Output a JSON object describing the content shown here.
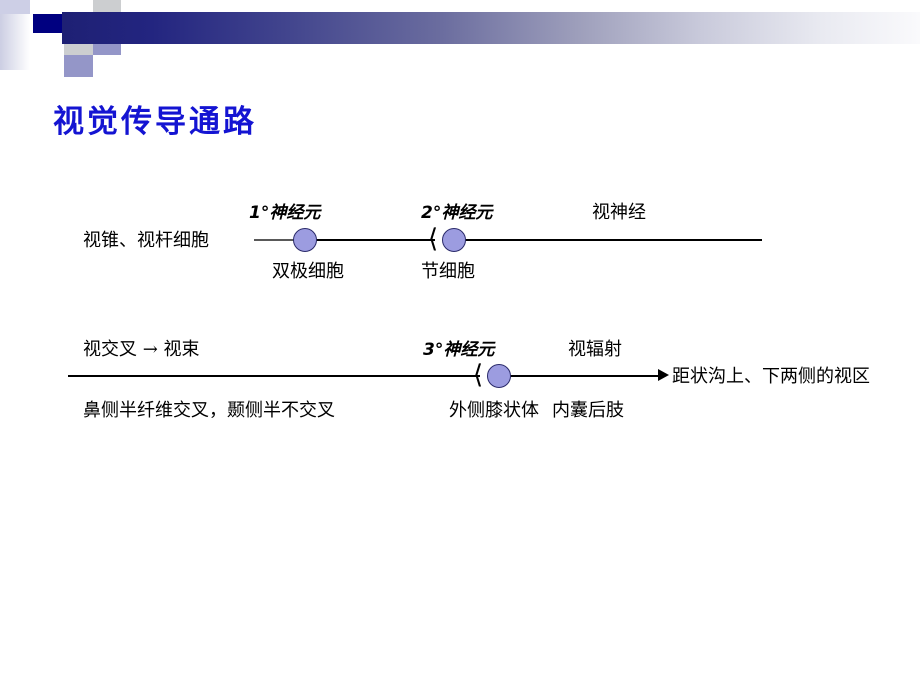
{
  "slide": {
    "title": "视觉传导通路",
    "title_color": "#1414d2",
    "background": "#ffffff"
  },
  "header": {
    "band_gradient_from": "#1e2074",
    "band_gradient_to": "#fafafc",
    "accent_navy": "#000080",
    "accent_dark": "#23237e",
    "accent_mid": "#9496c8",
    "accent_pale": "#cdcfe6"
  },
  "diagram": {
    "node_fill": "#9c9ce0",
    "node_stroke": "#2a2a6a",
    "rows": [
      {
        "id": "row-1",
        "left_label": "视锥、视杆细胞",
        "above_labels": [
          {
            "text": "1°神经元",
            "style": "italic"
          },
          {
            "text": "2°神经元",
            "style": "italic"
          },
          {
            "text": "视神经",
            "style": "normal"
          }
        ],
        "below_labels": [
          {
            "text": "双极细胞"
          },
          {
            "text": "节细胞"
          }
        ],
        "nodes": [
          {
            "name": "bipolar-cell-node",
            "synapse": false
          },
          {
            "name": "ganglion-cell-node",
            "synapse": true
          }
        ],
        "right_label": "",
        "arrow": false
      },
      {
        "id": "row-2",
        "left_label": "视交叉 → 视束",
        "above_labels": [
          {
            "text": "3°神经元",
            "style": "italic"
          },
          {
            "text": "视辐射",
            "style": "normal"
          }
        ],
        "below_labels": [
          {
            "text": "鼻侧半纤维交叉，颞侧半不交叉"
          },
          {
            "text": "外侧膝状体"
          },
          {
            "text": "内囊后肢"
          }
        ],
        "nodes": [
          {
            "name": "lateral-geniculate-body-node",
            "synapse": true
          }
        ],
        "right_label": "距状沟上、下两侧的视区",
        "arrow": true
      }
    ]
  }
}
